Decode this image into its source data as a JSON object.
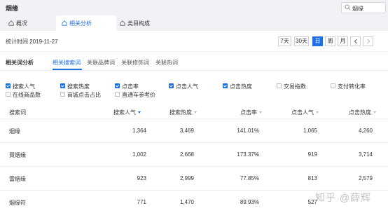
{
  "header": {
    "title": "烟缘",
    "search_value": "烟缘"
  },
  "nav": {
    "tabs": [
      {
        "label": "概况",
        "icon": "house-icon",
        "active": false
      },
      {
        "label": "相关分析",
        "icon": "house-icon",
        "active": true
      },
      {
        "label": "类目构成",
        "icon": "house-icon",
        "active": false
      }
    ]
  },
  "datebar": {
    "label": "统计时间 2019-11-27",
    "buttons": [
      "7天",
      "30天",
      "日",
      "周",
      "月"
    ],
    "active": "日",
    "prev_icon": "chevron-left-icon",
    "next_icon": "chevron-right-icon"
  },
  "section": {
    "title": "相关词分析",
    "subtabs": [
      "相关搜索词",
      "关联品牌词",
      "关联修饰词",
      "关联热词"
    ],
    "active_subtab": "相关搜索词"
  },
  "metrics": [
    {
      "label": "搜索人气",
      "checked": true
    },
    {
      "label": "搜索热度",
      "checked": true
    },
    {
      "label": "点击率",
      "checked": true
    },
    {
      "label": "点击人气",
      "checked": true
    },
    {
      "label": "点击热度",
      "checked": true
    },
    {
      "label": "交易指数",
      "checked": false
    },
    {
      "label": "支付转化率",
      "checked": false
    },
    {
      "label": "在线商品数",
      "checked": false
    },
    {
      "label": "商城点击占比",
      "checked": false
    },
    {
      "label": "直通车参考价",
      "checked": false
    }
  ],
  "table": {
    "columns": [
      "搜索词",
      "搜索人气",
      "搜索热度",
      "点击率",
      "点击人气",
      "点击热度"
    ],
    "sorted_column": "搜索人气",
    "rows": [
      [
        "烟缘",
        "1,364",
        "3,469",
        "141.01%",
        "1,065",
        "4,260"
      ],
      [
        "買烟缘",
        "1,002",
        "2,668",
        "173.37%",
        "919",
        "3,714"
      ],
      [
        "雷烟缘",
        "923",
        "2,999",
        "77.85%",
        "813",
        "2,579"
      ],
      [
        "烟缘符",
        "771",
        "1,470",
        "89.93%",
        "527",
        ""
      ]
    ]
  },
  "watermark": "知乎 @薛辉",
  "colors": {
    "accent": "#1f6fe5",
    "bar_bg": "#f0f2f5"
  }
}
